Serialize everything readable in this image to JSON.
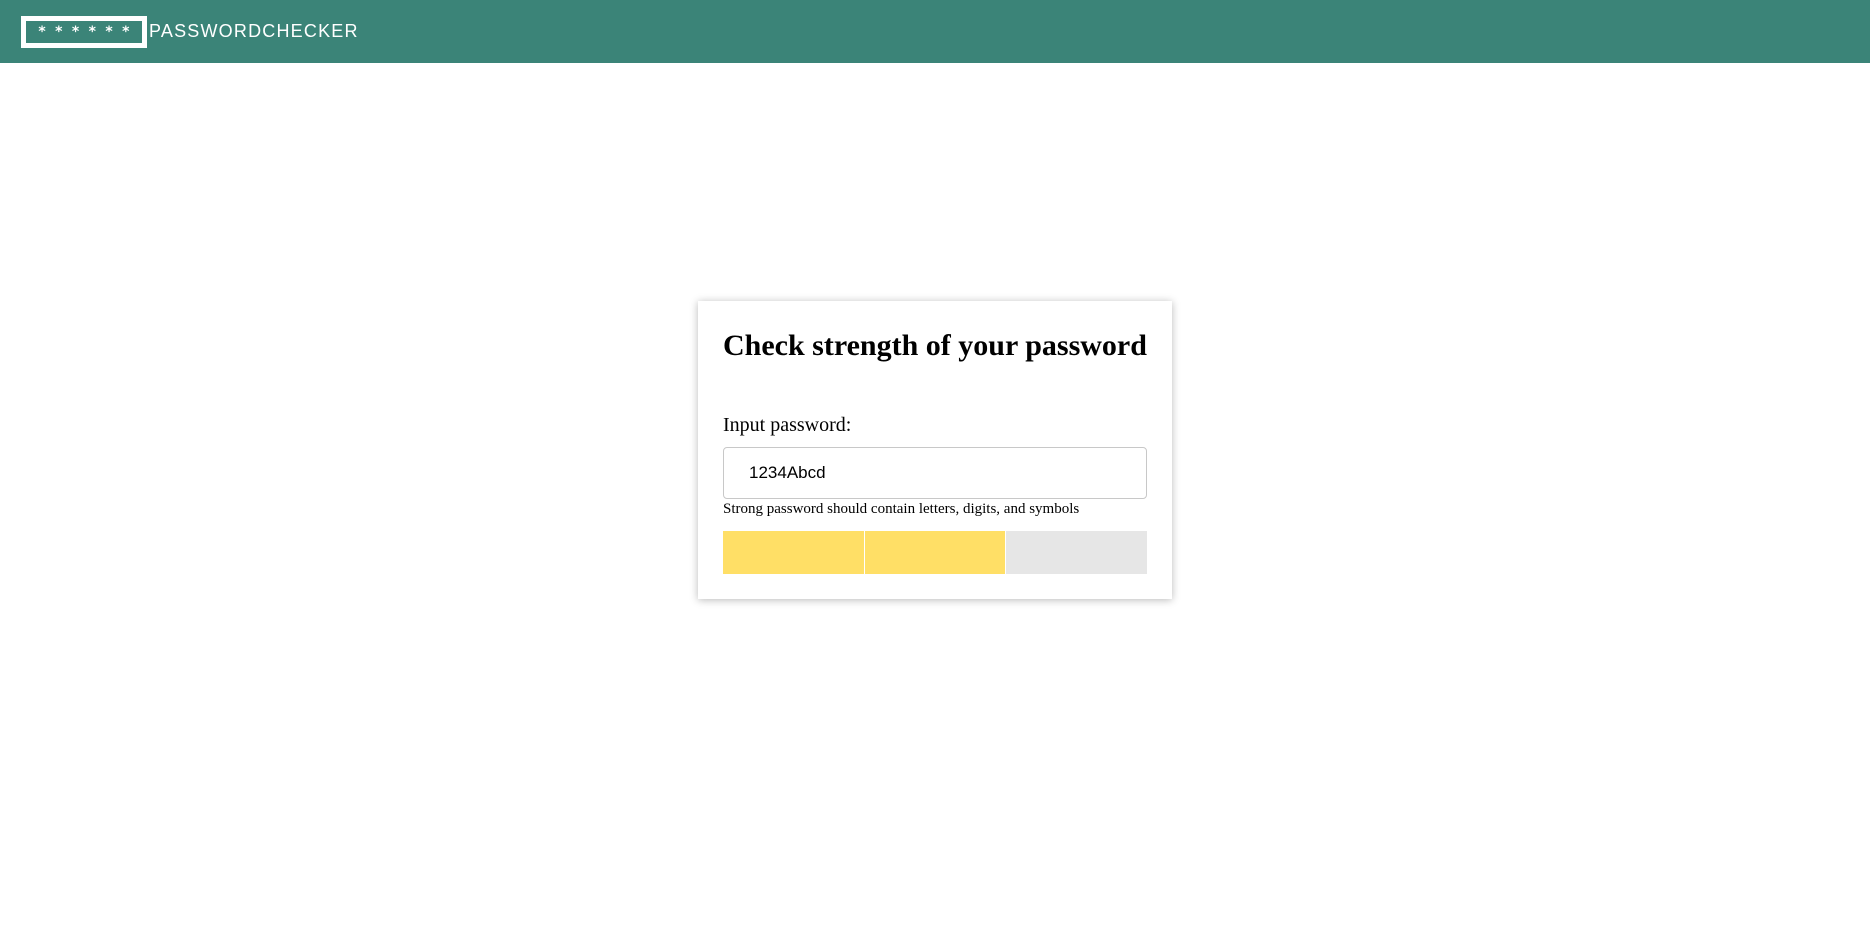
{
  "header": {
    "logo_dots": [
      "*",
      "*",
      "*",
      "*",
      "*",
      "*"
    ],
    "logo_text": "PASSWORDCHECKER",
    "bg_color": "#3b8478"
  },
  "card": {
    "title": "Check strength of your password",
    "input_label": "Input password:",
    "input_value": "1234Abcd",
    "hint": "Strong password should contain letters, digits, and symbols"
  },
  "strength_meter": {
    "level": 2,
    "max_level": 3,
    "active_color": "#ffdf66",
    "inactive_color": "#e6e6e6"
  }
}
